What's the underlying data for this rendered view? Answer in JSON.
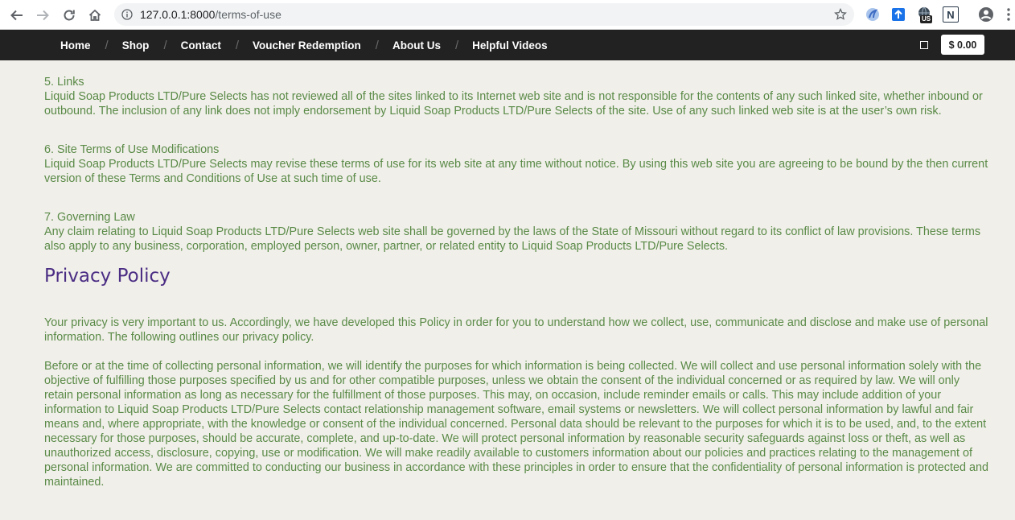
{
  "browser": {
    "url_host": "127.0.0.1:8000",
    "url_path": "/terms-of-use",
    "extensions": [
      {
        "name": "blue-swirl-extension-icon"
      },
      {
        "name": "upload-arrow-extension-icon"
      },
      {
        "name": "vpn-globe-extension-icon",
        "badge": "US"
      },
      {
        "name": "n-extension-icon",
        "label": "N"
      }
    ]
  },
  "nav": {
    "items": [
      "Home",
      "Shop",
      "Contact",
      "Voucher Redemption",
      "About Us",
      "Helpful Videos"
    ],
    "separator": "/",
    "cart_total": "$ 0.00"
  },
  "terms": [
    {
      "title": "5. Links",
      "body": "Liquid Soap Products LTD/Pure Selects has not reviewed all of the sites linked to its Internet web site and is not responsible for the contents of any such linked site, whether inbound or outbound. The inclusion of any link does not imply endorsement by Liquid Soap Products LTD/Pure Selects of the site. Use of any such linked web site is at the user’s own risk."
    },
    {
      "title": "6. Site Terms of Use Modifications",
      "body": "Liquid Soap Products LTD/Pure Selects may revise these terms of use for its web site at any time without notice. By using this web site you are agreeing to be bound by the then current version of these Terms and Conditions of Use at such time of use."
    },
    {
      "title": "7. Governing Law",
      "body": "Any claim relating to Liquid Soap Products LTD/Pure Selects web site shall be governed by the laws of the State of Missouri without regard to its conflict of law provisions. These terms also apply to any business, corporation, employed person, owner, partner, or related entity to Liquid Soap Products LTD/Pure Selects."
    }
  ],
  "privacy": {
    "heading": "Privacy Policy",
    "paragraphs": [
      "Your privacy is very important to us. Accordingly, we have developed this Policy in order for you to understand how we collect, use, communicate and disclose and make use of personal information. The following outlines our privacy policy.",
      "Before or at the time of collecting personal information, we will identify the purposes for which information is being collected. We will collect and use personal information solely with the objective of fulfilling those purposes specified by us and for other compatible purposes, unless we obtain the consent of the individual concerned or as required by law. We will only retain personal information as long as necessary for the fulfillment of those purposes. This may, on occasion, include reminder emails or calls. This may include addition of your information to Liquid Soap Products LTD/Pure Selects contact relationship management software, email systems or newsletters. We will collect personal information by lawful and fair means and, where appropriate, with the knowledge or consent of the individual concerned. Personal data should be relevant to the purposes for which it is to be used, and, to the extent necessary for those purposes, should be accurate, complete, and up-to-date. We will protect personal information by reasonable security safeguards against loss or theft, as well as unauthorized access, disclosure, copying, use or modification. We will make readily available to customers information about our policies and practices relating to the management of personal information. We are committed to conducting our business in accordance with these principles in order to ensure that the confidentiality of personal information is protected and maintained."
    ]
  },
  "colors": {
    "text": "#5a8a47",
    "heading": "#4b2d84",
    "navbar": "#222222",
    "page_bg": "#f0efe9"
  }
}
